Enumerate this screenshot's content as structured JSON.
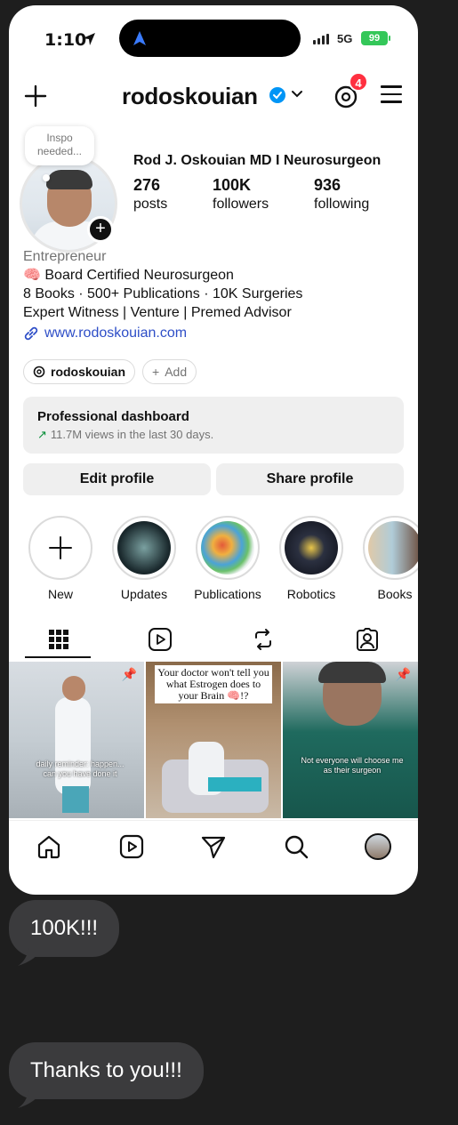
{
  "status_bar": {
    "time": "1:10",
    "network": "5G",
    "battery": "99"
  },
  "header": {
    "username": "rodoskouian",
    "notification_count": "4"
  },
  "profile": {
    "note": "Inspo needed...",
    "full_name": "Rod J. Oskouian MD I Neurosurgeon",
    "stats": [
      {
        "value": "276",
        "label": "posts"
      },
      {
        "value": "100K",
        "label": "followers"
      },
      {
        "value": "936",
        "label": "following"
      }
    ],
    "bio": {
      "category": "Entrepreneur",
      "line1": "🧠 Board Certified Neurosurgeon",
      "line2": "8 Books · 500+ Publications · 10K Surgeries",
      "line3": "Expert Witness | Venture | Premed Advisor",
      "link": "www.rodoskouian.com"
    },
    "threads_pill": "rodoskouian",
    "add_pill": "Add"
  },
  "dashboard": {
    "title": "Professional dashboard",
    "subtitle": "11.7M views in the last 30 days."
  },
  "buttons": {
    "edit": "Edit profile",
    "share": "Share profile"
  },
  "highlights": [
    "New",
    "Updates",
    "Publications",
    "Robotics",
    "Books"
  ],
  "posts": [
    {
      "caption": "daily reminder: happen... can you have done it"
    },
    {
      "caption": "Your doctor won't tell you what Estrogen does to your Brain 🧠!?"
    },
    {
      "caption": "Not everyone will choose me as their surgeon"
    }
  ],
  "messages": [
    "100K!!!",
    "Thanks to you!!!"
  ],
  "colors": {
    "badge": "#ff3040",
    "verified": "#0095f6",
    "link": "#2e4ec7",
    "bubble": "#3b3b3d"
  }
}
